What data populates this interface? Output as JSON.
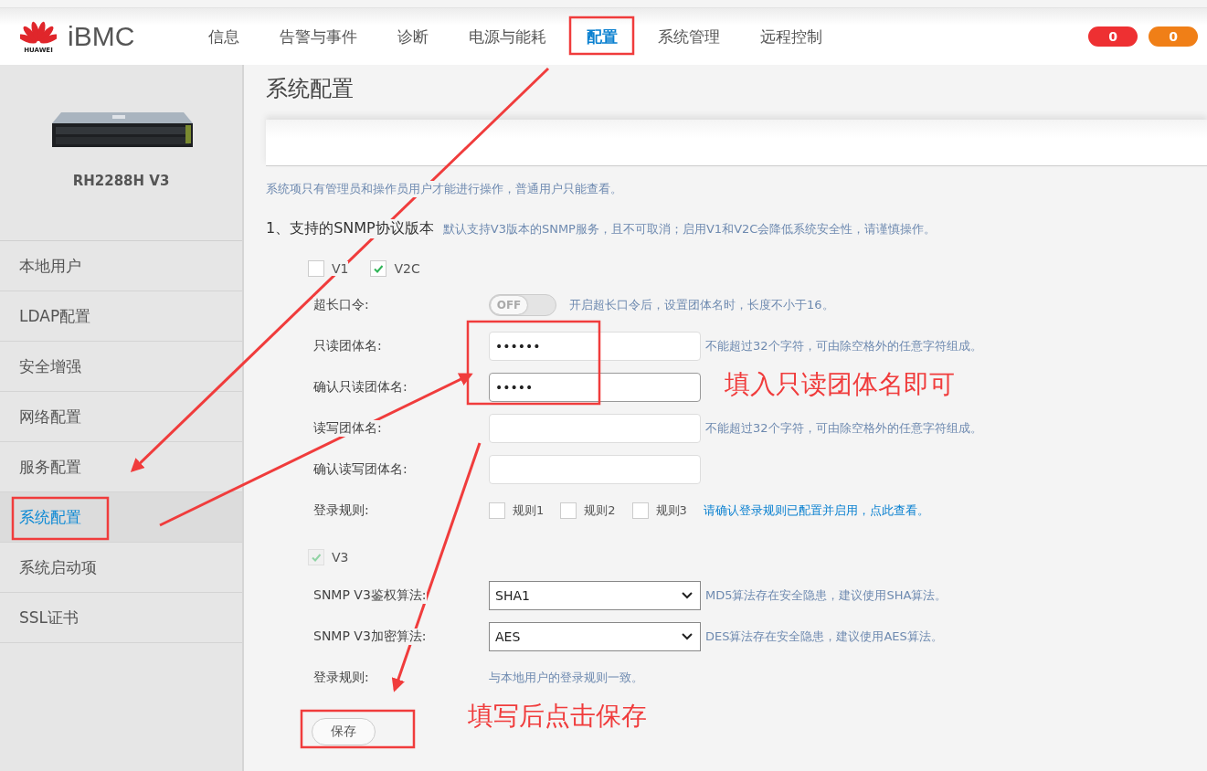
{
  "header": {
    "brand": "iBMC",
    "logo_caption": "HUAWEI",
    "nav": [
      {
        "label": "信息",
        "selected": false
      },
      {
        "label": "告警与事件",
        "selected": false
      },
      {
        "label": "诊断",
        "selected": false
      },
      {
        "label": "电源与能耗",
        "selected": false
      },
      {
        "label": "配置",
        "selected": true
      },
      {
        "label": "系统管理",
        "selected": false
      },
      {
        "label": "远程控制",
        "selected": false
      }
    ],
    "badges": [
      {
        "count": "0",
        "color": "#ee3032"
      },
      {
        "count": "0",
        "color": "#f07f17"
      }
    ]
  },
  "sidebar": {
    "device": {
      "kind": "picture",
      "name": "RH2288H V3"
    },
    "items": [
      {
        "label": "本地用户",
        "selected": false
      },
      {
        "label": "LDAP配置",
        "selected": false
      },
      {
        "label": "安全增强",
        "selected": false
      },
      {
        "label": "网络配置",
        "selected": false
      },
      {
        "label": "服务配置",
        "selected": false
      },
      {
        "label": "系统配置",
        "selected": true
      },
      {
        "label": "系统启动项",
        "selected": false
      },
      {
        "label": "SSL证书",
        "selected": false
      }
    ]
  },
  "page": {
    "title": "系统配置",
    "notice": "系统项只有管理员和操作员用户才能进行操作，普通用户只能查看。",
    "section": {
      "title": "1、支持的SNMP协议版本",
      "hint": "默认支持V3版本的SNMP服务，且不可取消；启用V1和V2C会降低系统安全性，请谨慎操作。"
    },
    "versions": [
      {
        "label": "V1",
        "checked": false
      },
      {
        "label": "V2C",
        "checked": true
      }
    ],
    "v2c_rows": [
      {
        "kind": "toggle",
        "label": "超长口令:",
        "toggle_text": "OFF",
        "on": false,
        "hint": "开启超长口令后，设置团体名时，长度不小于16。"
      },
      {
        "kind": "input",
        "label": "只读团体名:",
        "value": "••••••",
        "hint": "不能超过32个字符，可由除空格外的任意字符组成。"
      },
      {
        "kind": "input",
        "label": "确认只读团体名:",
        "value": "•••••",
        "focused": true
      },
      {
        "kind": "input",
        "label": "读写团体名:",
        "hint": "不能超过32个字符，可由除空格外的任意字符组成。"
      },
      {
        "kind": "input",
        "label": "确认读写团体名:"
      },
      {
        "kind": "rules",
        "label": "登录规则:",
        "rules": [
          {
            "label": "规则1",
            "checked": false
          },
          {
            "label": "规则2",
            "checked": false
          },
          {
            "label": "规则3",
            "checked": false
          }
        ],
        "link": "请确认登录规则已配置并启用，点此查看。"
      }
    ],
    "v3": {
      "label": "V3",
      "checked": true,
      "disabled": true
    },
    "v3_rows": [
      {
        "kind": "select",
        "label": "SNMP V3鉴权算法:",
        "value": "SHA1",
        "hint": "MD5算法存在安全隐患，建议使用SHA算法。"
      },
      {
        "kind": "select",
        "label": "SNMP V3加密算法:",
        "value": "AES",
        "hint": "DES算法存在安全隐患，建议使用AES算法。"
      },
      {
        "kind": "text",
        "label": "登录规则:",
        "text": "与本地用户的登录规则一致。"
      }
    ],
    "save_button": "保存"
  },
  "annotations": [
    "填入只读团体名即可",
    "填写后点击保存"
  ]
}
